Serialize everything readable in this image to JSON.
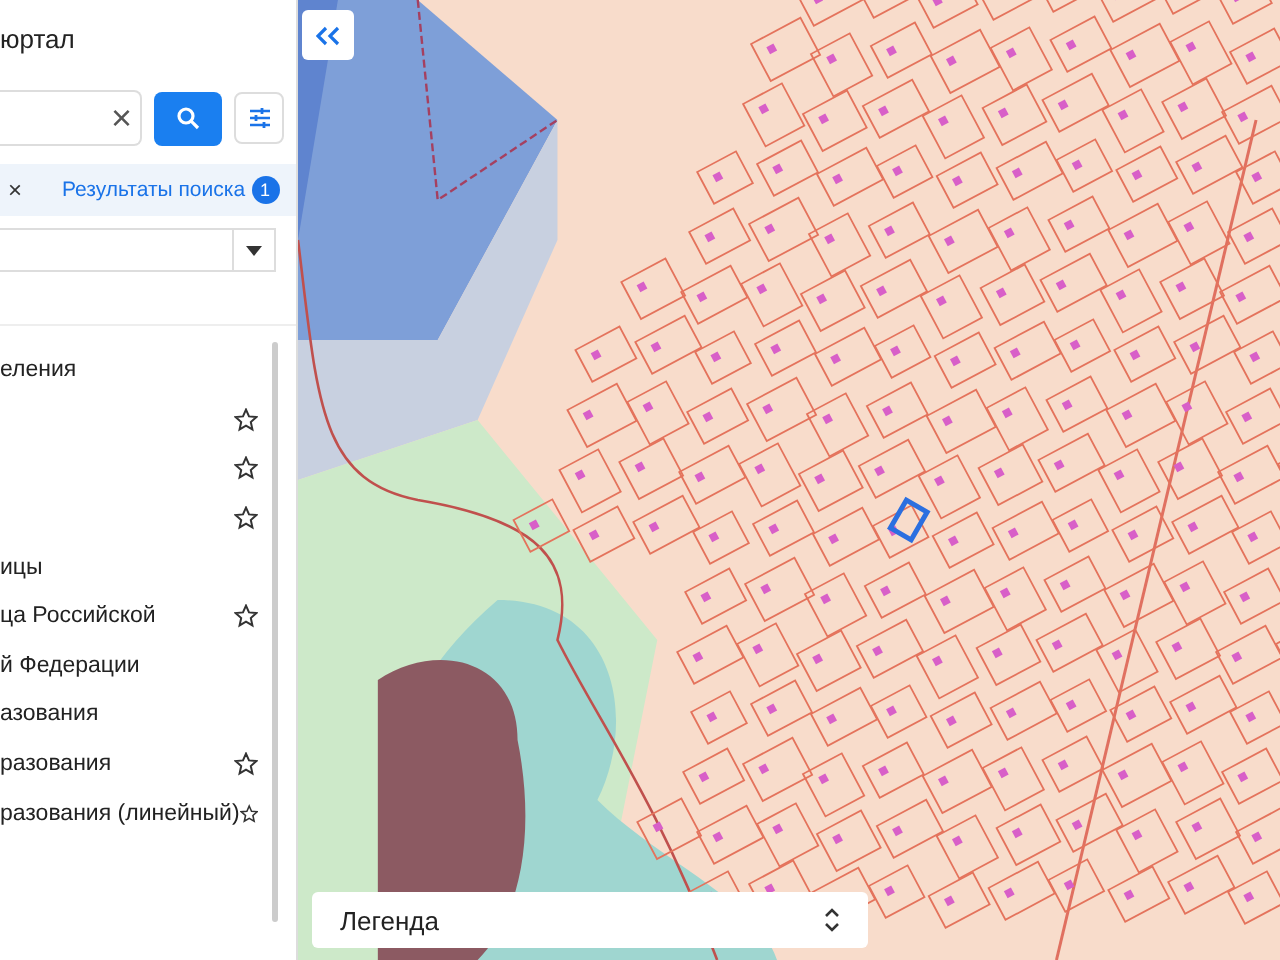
{
  "header": {
    "title": "юртал"
  },
  "search": {
    "clear_icon": "×"
  },
  "tabs": [
    {
      "label": "×",
      "kind": "close"
    },
    {
      "label": "Результаты поиска",
      "kind": "results",
      "badge": "1"
    }
  ],
  "layers": [
    {
      "label": "еления",
      "kind": "group"
    },
    {
      "kind": "layer"
    },
    {
      "kind": "layer"
    },
    {
      "kind": "layer"
    },
    {
      "label": "ицы",
      "kind": "group"
    },
    {
      "label": "ца Российской",
      "kind": "layer"
    },
    {
      "label": "й Федерации",
      "kind": "group"
    },
    {
      "label": "азования",
      "kind": "group"
    },
    {
      "label": "разования",
      "kind": "layer"
    },
    {
      "label": "разования (линейный)",
      "kind": "layer"
    }
  ],
  "legend": {
    "label": "Легенда"
  }
}
